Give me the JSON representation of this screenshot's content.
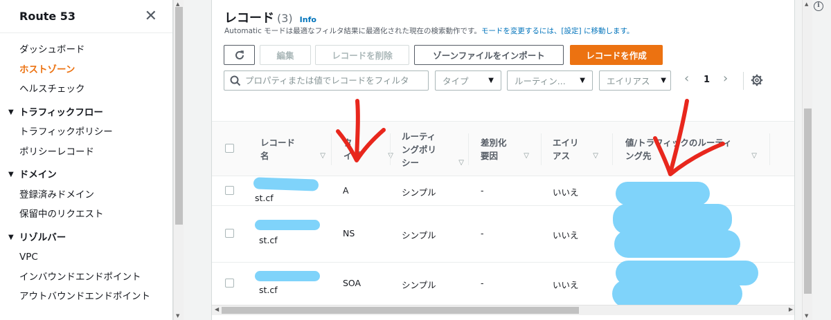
{
  "sidebar": {
    "title": "Route 53",
    "items_top": [
      "ダッシュボード",
      "ホストゾーン",
      "ヘルスチェック"
    ],
    "sections": [
      {
        "label": "トラフィックフロー",
        "items": [
          "トラフィックポリシー",
          "ポリシーレコード"
        ]
      },
      {
        "label": "ドメイン",
        "items": [
          "登録済みドメイン",
          "保留中のリクエスト"
        ]
      },
      {
        "label": "リゾルバー",
        "items": [
          "VPC",
          "インバウンドエンドポイント",
          "アウトバウンドエンドポイント"
        ]
      }
    ]
  },
  "main": {
    "title": "レコード",
    "count": "(3)",
    "info": "Info",
    "desc_pre": "Automatic モードは最適なフィルタ結果に最適化された現在の検索動作です。",
    "desc_link": "モードを変更するには、[設定] に移動します。",
    "buttons": {
      "edit": "編集",
      "delete": "レコードを削除",
      "import": "ゾーンファイルをインポート",
      "create": "レコードを作成"
    },
    "search_placeholder": "プロパティまたは値でレコードをフィルタ",
    "filters": {
      "type": "タイプ",
      "routing": "ルーティン...",
      "alias": "エイリアス"
    },
    "page": "1"
  },
  "table": {
    "headers": {
      "name": [
        "レコード",
        "名"
      ],
      "type": [
        "タ",
        "イプ"
      ],
      "routing": [
        "ルーティ",
        "ングポリ",
        "シー"
      ],
      "diff": [
        "差別化",
        "要因"
      ],
      "alias": [
        "エイリ",
        "アス"
      ],
      "value": [
        "値/トラフィックのルーティ",
        "ング先"
      ]
    },
    "rows": [
      {
        "name": "st.cf",
        "type": "A",
        "routing": "シンプル",
        "diff": "-",
        "alias": "いいえ"
      },
      {
        "name": "st.cf",
        "type": "NS",
        "routing": "シンプル",
        "diff": "-",
        "alias": "いいえ"
      },
      {
        "name": "st.cf",
        "type": "SOA",
        "routing": "シンプル",
        "diff": "-",
        "alias": "いいえ"
      }
    ]
  },
  "colors": {
    "accent": "#ec7211",
    "link": "#0073bb",
    "redaction": "#7fd3fa",
    "annotation": "#e8271d"
  }
}
